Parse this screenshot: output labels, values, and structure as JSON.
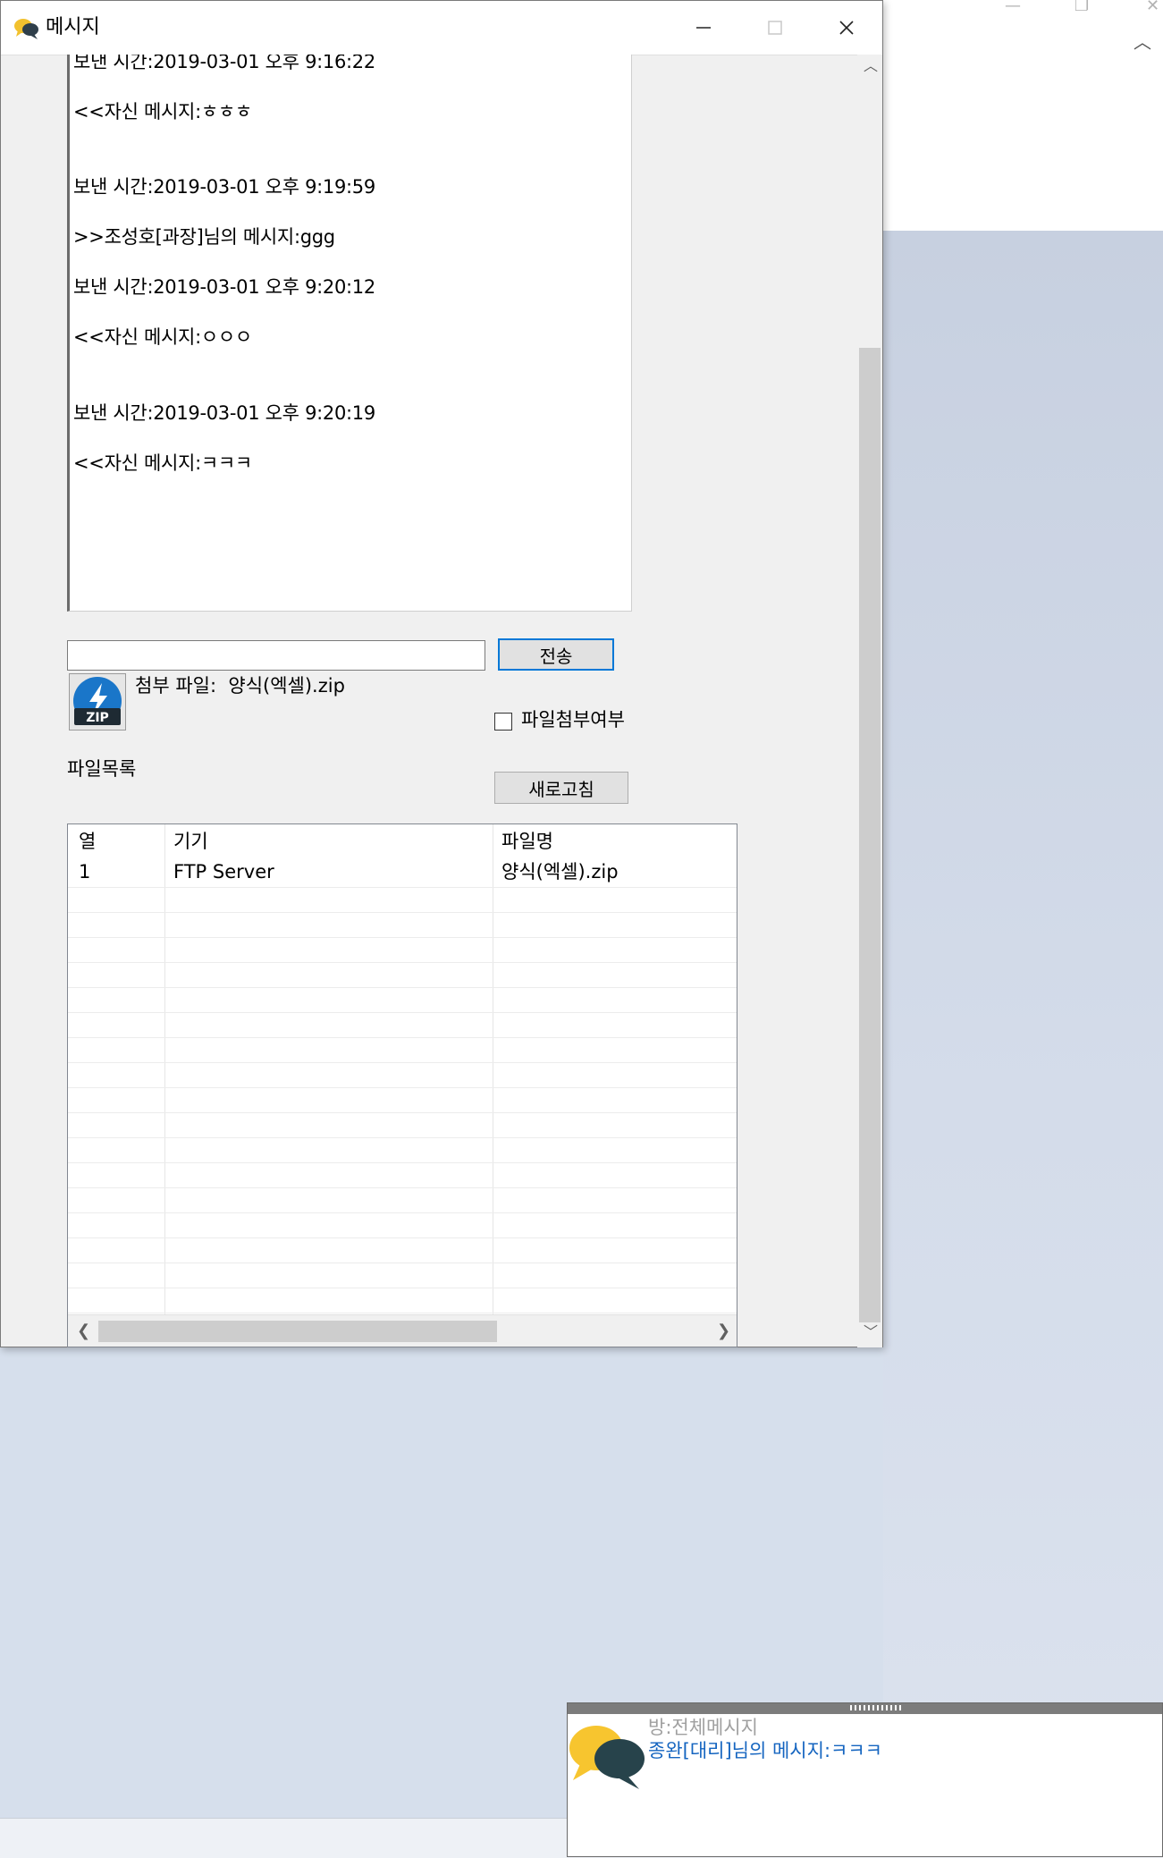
{
  "window": {
    "title": "메시지",
    "title_icon": "chat-bubbles-icon",
    "controls": [
      "minimize-icon",
      "maximize-icon",
      "close-icon"
    ]
  },
  "chat_log": {
    "lines": [
      "보낸 시간:2019-03-01 오후 9:16:22",
      "<<자신 메시지:ㅎㅎㅎ",
      "보낸 시간:2019-03-01 오후 9:19:59",
      ">>조성호[과장]님의 메시지:ggg",
      "보낸 시간:2019-03-01 오후 9:20:12",
      "<<자신 메시지:ㅇㅇㅇ",
      "보낸 시간:2019-03-01 오후 9:20:19",
      "<<자신 메시지:ㅋㅋㅋ"
    ]
  },
  "compose": {
    "input_value": "",
    "send_label": "전송",
    "attachment_label": "첨부 파일:  양식(엑셀).zip",
    "zip_icon_text": "ZIP",
    "attach_checkbox_label": "파일첨부여부",
    "attach_checked": false
  },
  "files": {
    "section_label": "파일목록",
    "refresh_label": "새로고침",
    "columns": [
      "열",
      "기기",
      "파일명"
    ],
    "rows": [
      {
        "index": "1",
        "device": "FTP Server",
        "filename": "양식(엑셀).zip"
      }
    ]
  },
  "notification": {
    "room": "방:전체메시지",
    "message": "종완[대리]님의 메시지:ㅋㅋㅋ"
  },
  "colors": {
    "accent": "#0078d7",
    "notify_text": "#1565c0",
    "background_canvas": "#c7d0e0"
  }
}
